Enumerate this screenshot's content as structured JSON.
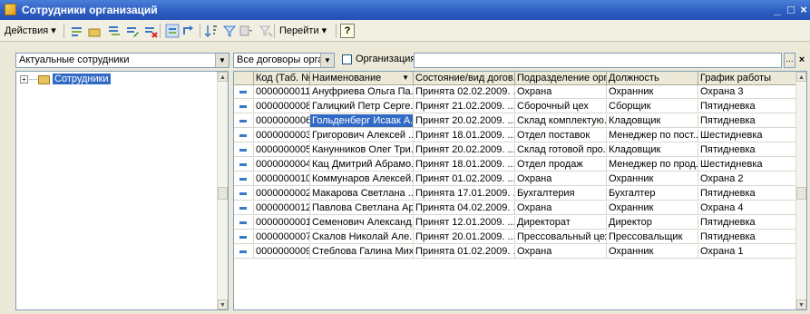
{
  "window": {
    "title": "Сотрудники организаций",
    "minimize": "_",
    "maximize": "□",
    "close": "×"
  },
  "toolbar": {
    "actions_label": "Действия ▾",
    "goto_label": "Перейти ▾",
    "help_label": "?"
  },
  "filters": {
    "employees_filter": "Актуальные сотрудники",
    "contracts_filter": "Все договоры орган",
    "organization_label": "Организация:",
    "organization_value": "",
    "organization_checked": false,
    "select_btn": "...",
    "clear_btn": "×"
  },
  "tree": {
    "root_label": "Сотрудники"
  },
  "table": {
    "columns": [
      "Код (Таб. №)",
      "Наименование",
      "Состояние/вид догов...",
      "Подразделение орг...",
      "Должность",
      "График работы"
    ],
    "rows": [
      [
        "0000000011",
        "Ануфриева Ольга Па...",
        "Принята 02.02.2009. ...",
        "Охрана",
        "Охранник",
        "Охрана 3"
      ],
      [
        "0000000008",
        "Галицкий Петр Серге...",
        "Принят 21.02.2009. ...",
        "Сборочный цех",
        "Сборщик",
        "Пятидневка"
      ],
      [
        "0000000006",
        "Гольденберг Исаак А...",
        "Принят 20.02.2009. ...",
        "Склад комплектую...",
        "Кладовщик",
        "Пятидневка"
      ],
      [
        "0000000003",
        "Григорович Алексей ...",
        "Принят 18.01.2009. ...",
        "Отдел поставок",
        "Менеджер по пост...",
        "Шестидневка"
      ],
      [
        "0000000005",
        "Канунников Олег Три...",
        "Принят 20.02.2009. ...",
        "Склад готовой про...",
        "Кладовщик",
        "Пятидневка"
      ],
      [
        "0000000004",
        "Кац Дмитрий Абрамо...",
        "Принят 18.01.2009. ...",
        "Отдел продаж",
        "Менеджер по прод...",
        "Шестидневка"
      ],
      [
        "0000000010",
        "Коммунаров Алексей...",
        "Принят 01.02.2009. ...",
        "Охрана",
        "Охранник",
        "Охрана 2"
      ],
      [
        "0000000002",
        "Макарова Светлана ...",
        "Принята 17.01.2009. ...",
        "Бухгалтерия",
        "Бухгалтер",
        "Пятидневка"
      ],
      [
        "0000000012",
        "Павлова Светлана Ар...",
        "Принята 04.02.2009. ...",
        "Охрана",
        "Охранник",
        "Охрана 4"
      ],
      [
        "0000000001",
        "Семенович Александ...",
        "Принят 12.01.2009. ...",
        "Директорат",
        "Директор",
        "Пятидневка"
      ],
      [
        "0000000007",
        "Скалов Николай Але...",
        "Принят 20.01.2009. ...",
        "Прессовальный цех",
        "Прессовальщик",
        "Пятидневка"
      ],
      [
        "0000000009",
        "Стеблова Галина Мих...",
        "Принята 01.02.2009. ...",
        "Охрана",
        "Охранник",
        "Охрана 1"
      ]
    ],
    "selected_row": 2
  },
  "colors": {
    "title_bar": "#2c5cc0",
    "selection": "#316ac5",
    "toolbar": "#f1efe2"
  }
}
